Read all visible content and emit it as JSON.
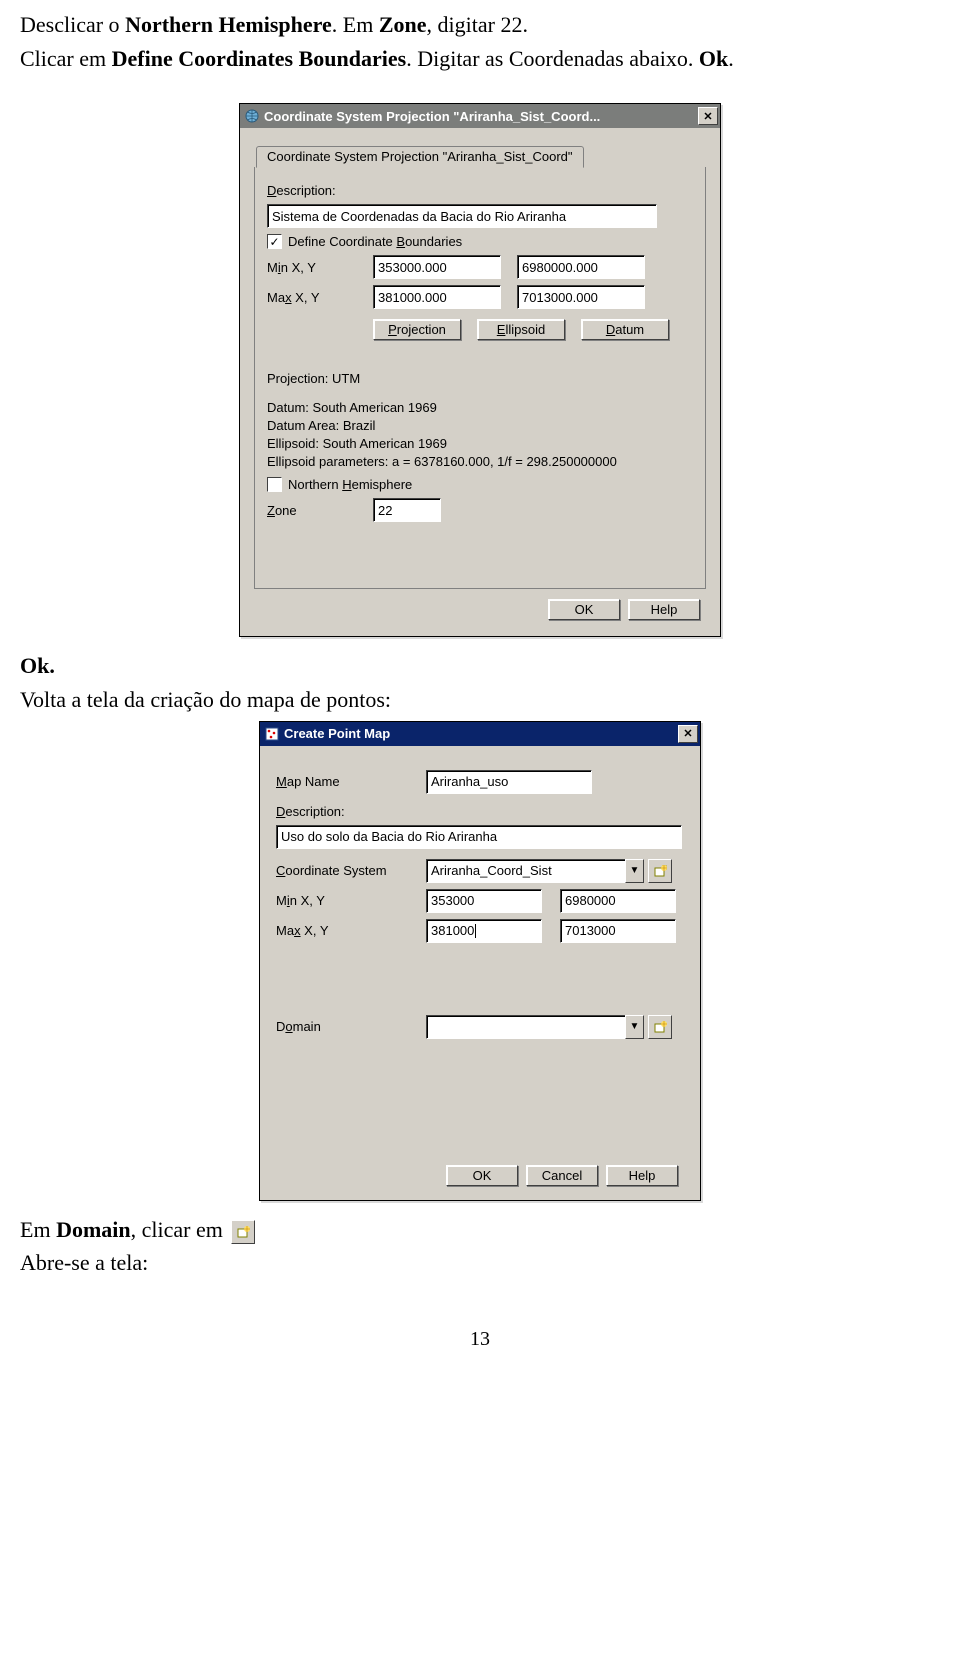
{
  "doc": {
    "line1a": "Desclicar o ",
    "line1b": "Northern Hemisphere",
    "line1c": ". Em ",
    "line1d": "Zone",
    "line1e": ", digitar 22.",
    "line2a": "Clicar em ",
    "line2b": "Define Coordinates Boundaries",
    "line2c": ". Digitar as Coordenadas abaixo. ",
    "line2d": "Ok",
    "line2e": ".",
    "ok_again": "Ok.",
    "volta": "Volta a tela da criação do mapa de pontos:",
    "em_domain_a": "Em ",
    "em_domain_b": "Domain",
    "em_domain_c": ", clicar em",
    "abre": "Abre-se a tela:",
    "pagenum": "13"
  },
  "dlg1": {
    "title": "Coordinate System Projection \"Ariranha_Sist_Coord...",
    "tab": "Coordinate System Projection \"Ariranha_Sist_Coord\"",
    "labels": {
      "description": "Description:",
      "define_bounds": "Define Coordinate Boundaries",
      "minxy_pre": "M",
      "minxy_u": "i",
      "minxy_post": "n X, Y",
      "maxxy_pre": "Ma",
      "maxxy_u": "x",
      "maxxy_post": " X, Y",
      "projection_btn_u": "P",
      "projection_btn_post": "rojection",
      "ellipsoid_btn_u": "E",
      "ellipsoid_btn_post": "llipsoid",
      "datum_btn_u": "D",
      "datum_btn_post": "atum",
      "northern_pre": "Northern ",
      "northern_u": "H",
      "northern_post": "emisphere",
      "zone_u": "Z",
      "zone_post": "one"
    },
    "values": {
      "description": "Sistema de Coordenadas da Bacia do Rio Ariranha",
      "define_bounds_checked": "✓",
      "min_x": "353000.000",
      "min_y": "6980000.000",
      "max_x": "381000.000",
      "max_y": "7013000.000",
      "zone": "22"
    },
    "info": {
      "proj": "Projection: UTM",
      "datum": "Datum: South American 1969",
      "area": "Datum Area: Brazil",
      "ellipsoid": "Ellipsoid: South American 1969",
      "params": "Ellipsoid parameters: a = 6378160.000, 1/f = 298.250000000"
    },
    "buttons": {
      "ok": "OK",
      "help": "Help"
    }
  },
  "dlg2": {
    "title": "Create Point Map",
    "labels": {
      "mapname_u": "M",
      "mapname_post": "ap Name",
      "description_u": "D",
      "description_post": "escription:",
      "coordsys_u": "C",
      "coordsys_post": "oordinate System",
      "minxy_pre": "M",
      "minxy_u": "i",
      "minxy_post": "n X, Y",
      "maxxy_pre": "Ma",
      "maxxy_u": "x",
      "maxxy_post": " X, Y",
      "domain_pre": "D",
      "domain_u": "o",
      "domain_post": "main"
    },
    "values": {
      "mapname": "Ariranha_uso",
      "description": "Uso do solo da Bacia do Rio Ariranha",
      "coordsys": "Ariranha_Coord_Sist",
      "min_x": "353000",
      "min_y": "6980000",
      "max_x": "381000",
      "max_y": "7013000",
      "domain": ""
    },
    "buttons": {
      "ok": "OK",
      "cancel": "Cancel",
      "help": "Help"
    }
  }
}
